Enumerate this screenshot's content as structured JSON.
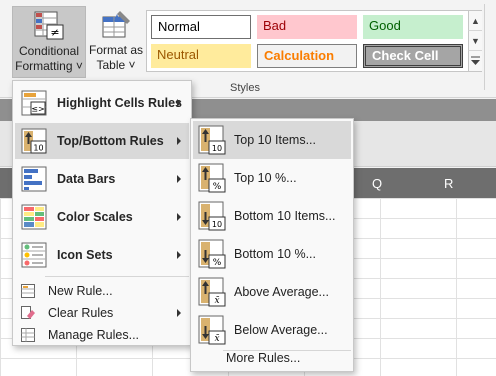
{
  "ribbon": {
    "conditional_formatting": {
      "line1": "Conditional",
      "line2": "Formatting ˅"
    },
    "format_as_table": {
      "line1": "Format as",
      "line2": "Table ˅"
    },
    "styles_group_label": "Styles",
    "styles": {
      "normal": "Normal",
      "bad": "Bad",
      "good": "Good",
      "neutral": "Neutral",
      "calculation": "Calculation",
      "check_cell": "Check Cell"
    }
  },
  "sheet": {
    "columns": [
      "Q",
      "R"
    ]
  },
  "menu": {
    "items": [
      {
        "label": "Highlight Cells Rules",
        "icon": "highlight-cells-icon",
        "submenu": true
      },
      {
        "label": "Top/Bottom Rules",
        "icon": "top-bottom-icon",
        "submenu": true,
        "active": true
      },
      {
        "label": "Data Bars",
        "icon": "data-bars-icon",
        "submenu": true
      },
      {
        "label": "Color Scales",
        "icon": "color-scales-icon",
        "submenu": true
      },
      {
        "label": "Icon Sets",
        "icon": "icon-sets-icon",
        "submenu": true
      }
    ],
    "actions": [
      {
        "label": "New Rule...",
        "icon": "new-rule-icon"
      },
      {
        "label": "Clear Rules",
        "icon": "clear-rules-icon",
        "submenu": true
      },
      {
        "label": "Manage Rules...",
        "icon": "manage-rules-icon"
      }
    ]
  },
  "submenu": {
    "items": [
      {
        "label": "Top 10 Items...",
        "icon": "top-10-items-icon",
        "badge": "10"
      },
      {
        "label": "Top 10 %...",
        "icon": "top-10-percent-icon",
        "badge": "%"
      },
      {
        "label": "Bottom 10 Items...",
        "icon": "bottom-10-items-icon",
        "badge": "10"
      },
      {
        "label": "Bottom 10 %...",
        "icon": "bottom-10-percent-icon",
        "badge": "%"
      },
      {
        "label": "Above Average...",
        "icon": "above-average-icon",
        "badge": "x̄"
      },
      {
        "label": "Below Average...",
        "icon": "below-average-icon",
        "badge": "x̄"
      }
    ],
    "more": "More Rules..."
  },
  "colors": {
    "menu_highlight": "#d9d9d9",
    "bad_fill": "#ffc7ce",
    "good_fill": "#c6efce",
    "neutral_fill": "#ffeb9c",
    "calculation_text": "#fa7d00",
    "check_cell_fill": "#a5a5a5"
  }
}
